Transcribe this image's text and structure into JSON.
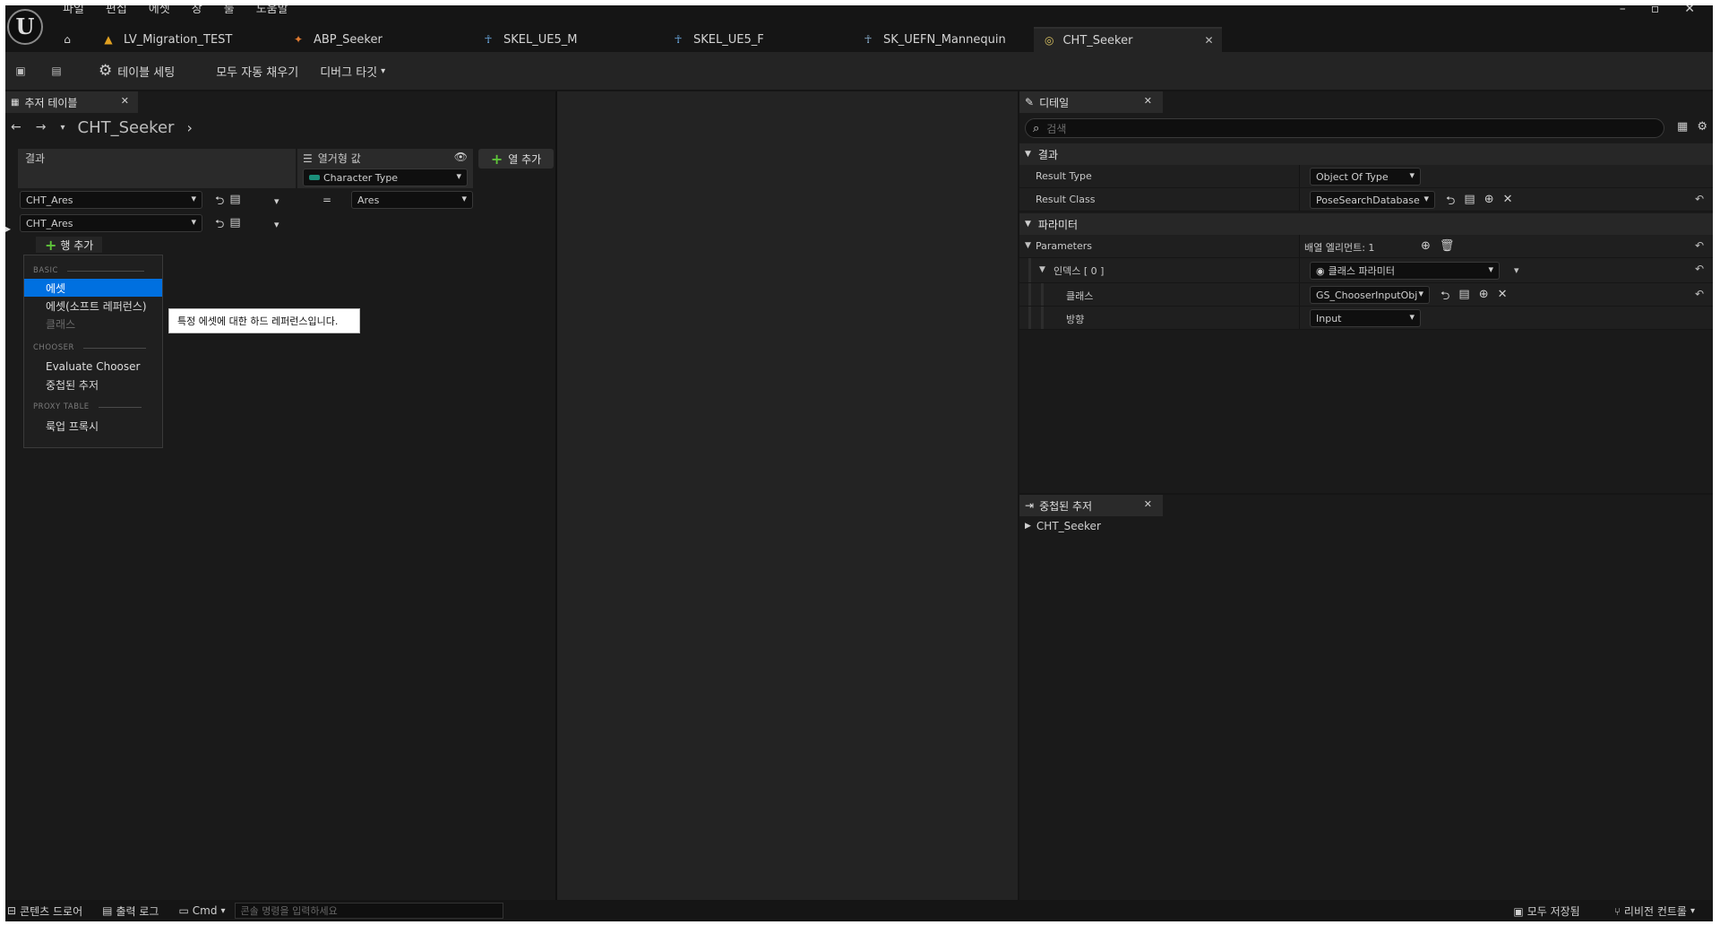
{
  "app": {
    "menu": [
      "파일",
      "편집",
      "에셋",
      "창",
      "툴",
      "도움말"
    ],
    "tabs": [
      {
        "label": "LV_Migration_TEST",
        "icon": "level-icon"
      },
      {
        "label": "ABP_Seeker",
        "icon": "anim-blueprint-icon"
      },
      {
        "label": "SKEL_UE5_M",
        "icon": "skeleton-icon"
      },
      {
        "label": "SKEL_UE5_F",
        "icon": "skeleton-icon"
      },
      {
        "label": "SK_UEFN_Mannequin",
        "icon": "skeletal-mesh-icon"
      },
      {
        "label": "CHT_Seeker",
        "icon": "chooser-table-icon",
        "active": true
      }
    ]
  },
  "toolbar": {
    "table_settings": "테이블 세팅",
    "auto_fill": "모두 자동 채우기",
    "debug_target": "디버그 타깃"
  },
  "left": {
    "panel_tab": "추저 테이블",
    "breadcrumb_title": "CHT_Seeker",
    "result_header": "결과",
    "enum_header": "열거형 값",
    "enum_type": "Character Type",
    "add_column": "열 추가",
    "rows": [
      {
        "result": "CHT_Ares",
        "enum_value": "Ares",
        "operator": "="
      },
      {
        "result": "CHT_Ares"
      }
    ],
    "add_row": "행 추가"
  },
  "dropdown": {
    "sections": [
      {
        "title": "BASIC",
        "items": [
          "에셋",
          "에셋(소프트 레퍼런스)",
          "클래스"
        ]
      },
      {
        "title": "CHOOSER",
        "items": [
          "Evaluate Chooser",
          "중첩된 추저"
        ]
      },
      {
        "title": "PROXY TABLE",
        "items": [
          "룩업 프록시"
        ]
      }
    ],
    "tooltip": "특정 에셋에 대한 하드 레퍼런스입니다."
  },
  "details": {
    "tab": "디테일",
    "search_placeholder": "검색",
    "sections": {
      "result": "결과",
      "params": "파라미터"
    },
    "result_type": {
      "name": "Result Type",
      "value": "Object Of Type"
    },
    "result_class": {
      "name": "Result Class",
      "value": "PoseSearchDatabase"
    },
    "parameters": {
      "name": "Parameters",
      "value": "배열 엘리먼트: 1"
    },
    "index0": {
      "name": "인덱스 [ 0 ]",
      "value": "클래스 파라미터"
    },
    "klass": {
      "name": "클래스",
      "value": "GS_ChooserInputObj"
    },
    "direction": {
      "name": "방향",
      "value": "Input"
    }
  },
  "nested": {
    "tab": "중첩된 추저",
    "item": "CHT_Seeker"
  },
  "status": {
    "content_drawer": "콘텐츠 드로어",
    "output_log": "출력 로그",
    "cmd": "Cmd",
    "cmd_placeholder": "콘솔 명령을 입력하세요",
    "save_all": "모두 저장됨",
    "revision": "리비전 컨트롤"
  }
}
